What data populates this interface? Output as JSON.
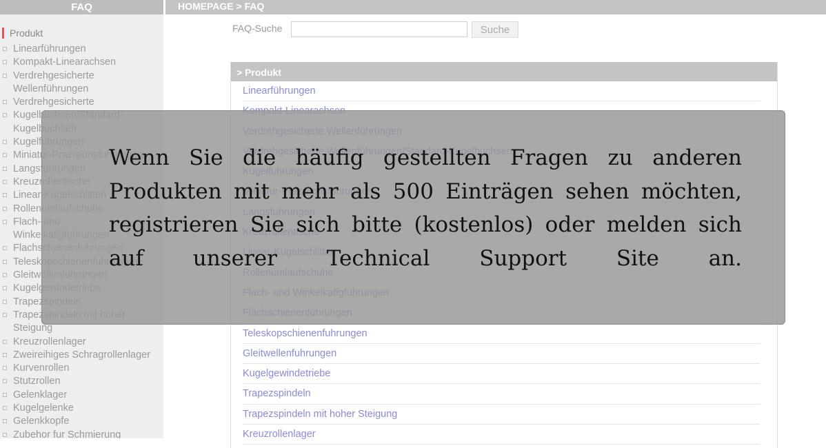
{
  "topbar": {
    "section_title": "FAQ",
    "breadcrumb": "HOMEPAGE > FAQ"
  },
  "sidebar": {
    "heading": "Produkt",
    "items": [
      "Linearführungen",
      "Kompakt-Linearachsen",
      "Verdrehgesicherte Wellenführungen",
      "Verdrehgesicherte",
      "Kugelbuchsen/Standard-Kugelbuchsen",
      "Kugelfuhrungen",
      "Miniatur-Prazisionsfuhrungen",
      "Langsfuhrungen",
      "Kreuzrollentische",
      "Linear-Kugelschlitten",
      "Rollenumlaufschuhe",
      "Flach- und Winkelkafigfuhrungen",
      "Flachschienenfuhrungen",
      "Teleskopschienenfuhrungen",
      "Gleitwellenfuhrungen",
      "Kugelgewindetriebe",
      "Trapezspindeln",
      "Trapezspindeln mit hoher Steigung",
      "Kreuzrollenlager",
      "Zweireihiges Schragrollenlager",
      "Kurvenrollen",
      "Stutzrollen",
      "Gelenklager",
      "Kugelgelenke",
      "Gelenkkopfe",
      "Zubehor fur Schmierung"
    ]
  },
  "search": {
    "label": "FAQ-Suche",
    "value": "",
    "button_label": "Suche"
  },
  "panel": {
    "title": "> Produkt",
    "items": [
      "Linearführungen",
      "Kompakt-Linearachsen",
      "Verdrehgesicherte Wellenführungen",
      "Verdrehgesicherte Wellenführungen/Standard-Kugelbuchsen",
      "Kugelfuhrungen",
      "Miniatur-Prazisionsfuhrungen",
      "Langsfuhrungen",
      "Kreuzrollentische",
      "Linear-Kugelschlitten",
      "Rollenumlaufschuhe",
      "Flach- und Winkelkafigfuhrungen",
      "Flachschienenfuhrungen",
      "Teleskopschienenfuhrungen",
      "Gleitwellenfuhrungen",
      "Kugelgewindetriebe",
      "Trapezspindeln",
      "Trapezspindeln mit hoher Steigung",
      "Kreuzrollenlager"
    ]
  },
  "overlay": {
    "message": "Wenn Sie die häufig gestellten Fragen zu anderen Produkten mit mehr als 500 Einträgen sehen möchten, registrieren Sie sich bitte (kostenlos) oder melden sich auf unserer Technical Support Site an."
  }
}
